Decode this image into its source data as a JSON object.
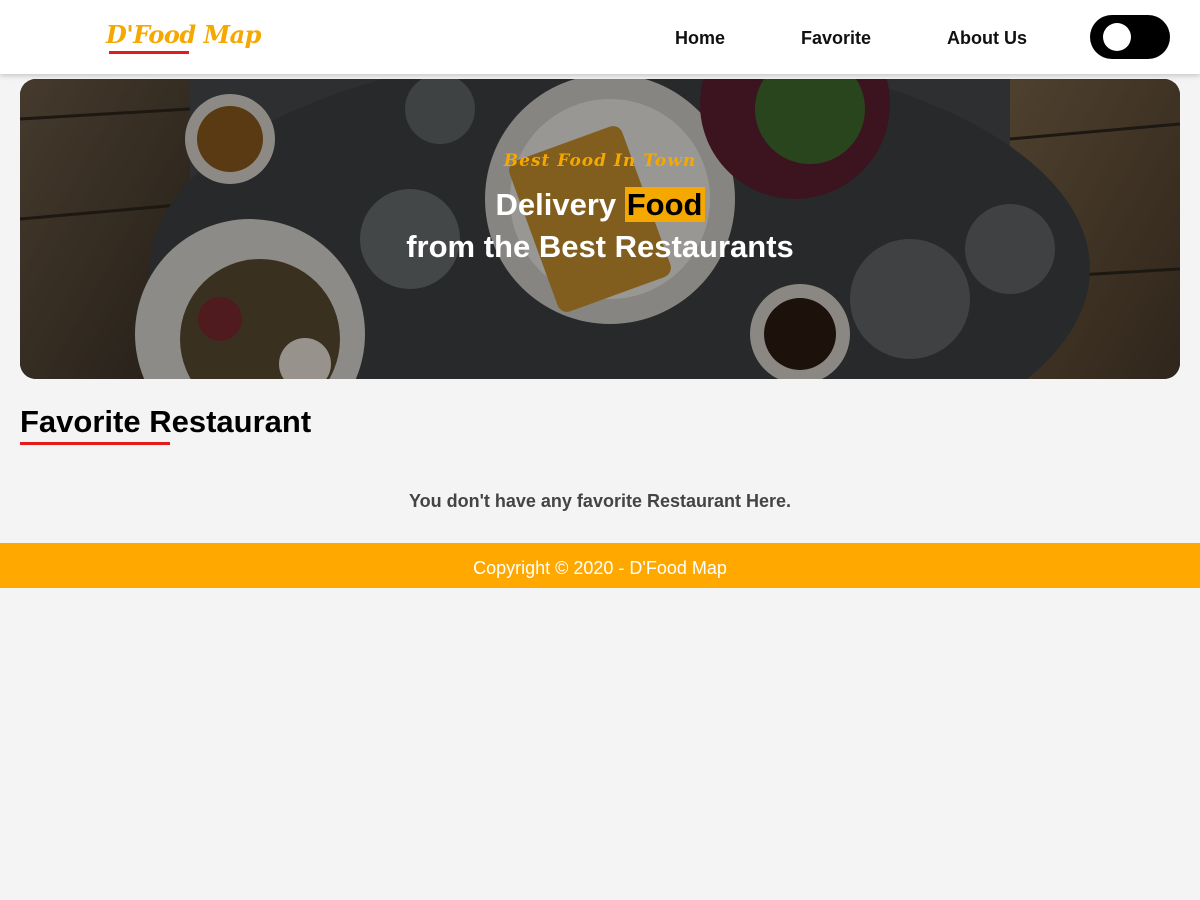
{
  "header": {
    "brand": "D'Food Map",
    "nav": [
      {
        "label": "Home"
      },
      {
        "label": "Favorite"
      },
      {
        "label": "About Us"
      }
    ],
    "theme_toggle": {
      "state": "off"
    }
  },
  "hero": {
    "tagline": "Best Food In Town",
    "headline_prefix": "Delivery",
    "headline_highlight": "Food",
    "headline_line2": "from the Best Restaurants"
  },
  "main": {
    "section_title": "Favorite Restaurant",
    "empty_message": "You don't have any favorite Restaurant Here."
  },
  "footer": {
    "text": "Copyright © 2020 - D'Food Map"
  },
  "colors": {
    "accent": "#f5a800",
    "underline_red": "#e41b1b",
    "footer_bg": "#ffa800",
    "page_bg": "#f4f4f4"
  }
}
